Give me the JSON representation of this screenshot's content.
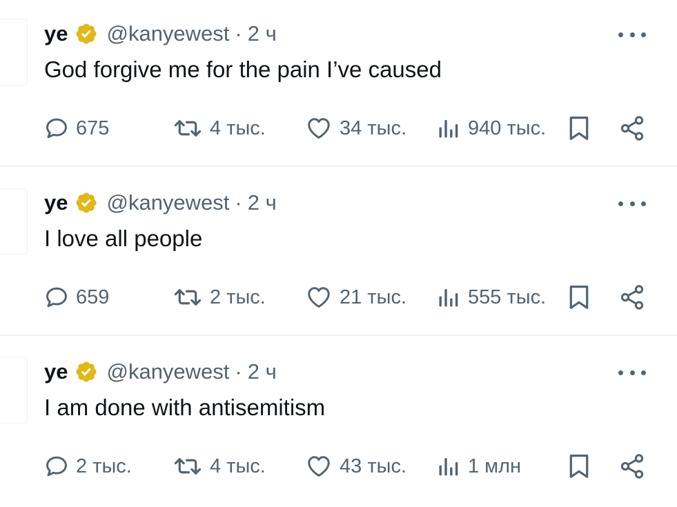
{
  "tweets": [
    {
      "name": "ye",
      "handle": "@kanyewest",
      "separator": "·",
      "time": "2 ч",
      "text": "God forgive me for the pain I’ve caused",
      "replies": "675",
      "retweets": "4 тыс.",
      "likes": "34 тыс.",
      "views": "940 тыс."
    },
    {
      "name": "ye",
      "handle": "@kanyewest",
      "separator": "·",
      "time": "2 ч",
      "text": "I love all people",
      "replies": "659",
      "retweets": "2 тыс.",
      "likes": "21 тыс.",
      "views": "555 тыс."
    },
    {
      "name": "ye",
      "handle": "@kanyewest",
      "separator": "·",
      "time": "2 ч",
      "text": "I am done with antisemitism",
      "replies": "2 тыс.",
      "retweets": "4 тыс.",
      "likes": "43 тыс.",
      "views": "1 млн"
    }
  ],
  "colors": {
    "text_primary": "#0f1419",
    "text_secondary": "#536471",
    "verified_badge": "#e2b719",
    "divider": "#eff3f4"
  },
  "icons": {
    "reply": "reply-icon",
    "retweet": "retweet-icon",
    "like": "heart-icon",
    "views": "views-icon",
    "bookmark": "bookmark-icon",
    "share": "share-icon",
    "more": "more-icon",
    "verified": "verified-badge-icon"
  }
}
